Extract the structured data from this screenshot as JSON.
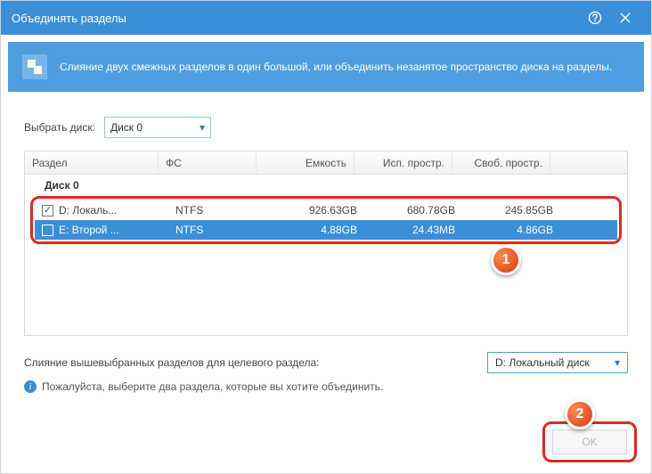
{
  "window": {
    "title": "Объединять разделы"
  },
  "banner": {
    "text": "Слияние двух смежных разделов в один большой, или объединить незанятое пространство диска на разделы."
  },
  "diskSelect": {
    "label": "Выбрать диск:",
    "value": "Диск 0"
  },
  "columns": {
    "part": "Раздел",
    "fs": "ФС",
    "cap": "Емкость",
    "used": "Исп. простр.",
    "free": "Своб. простр."
  },
  "group": {
    "label": "Диск 0"
  },
  "rows": [
    {
      "checked": true,
      "selected": false,
      "part": "D: Локаль...",
      "fs": "NTFS",
      "cap": "926.63GB",
      "used": "680.78GB",
      "free": "245.85GB"
    },
    {
      "checked": false,
      "selected": true,
      "part": "E: Второй ...",
      "fs": "NTFS",
      "cap": "4.88GB",
      "used": "24.43MB",
      "free": "4.86GB"
    }
  ],
  "target": {
    "label": "Слияние вышевыбранных разделов для целевого раздела:",
    "value": "D: Локальный диск"
  },
  "hint": {
    "text": "Пожалуйста, выберите два раздела, которые вы хотите объединить."
  },
  "buttons": {
    "ok": "OK"
  },
  "steps": {
    "one": "1",
    "two": "2"
  }
}
